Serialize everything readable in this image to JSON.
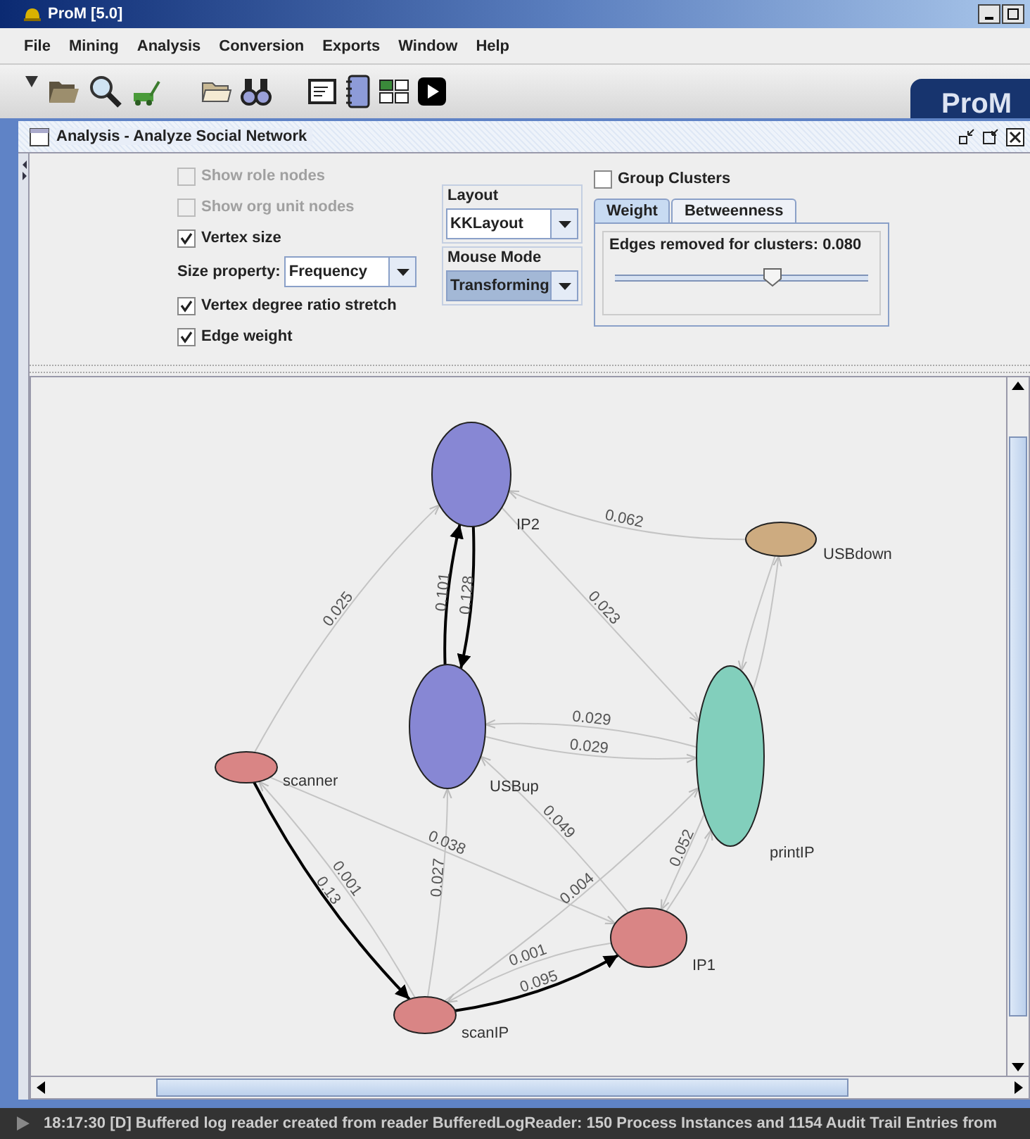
{
  "window": {
    "title": "ProM [5.0]"
  },
  "menu": [
    "File",
    "Mining",
    "Analysis",
    "Conversion",
    "Exports",
    "Window",
    "Help"
  ],
  "logo": "ProM",
  "frame": {
    "title": "Analysis - Analyze Social Network"
  },
  "options": [
    {
      "kind": "checkbox",
      "label": "Show role nodes",
      "checked": false,
      "disabled": true
    },
    {
      "kind": "checkbox",
      "label": "Show org unit nodes",
      "checked": false,
      "disabled": true
    },
    {
      "kind": "checkbox",
      "label": "Vertex size",
      "checked": true,
      "disabled": false
    },
    {
      "kind": "combo",
      "label": "Size property:",
      "value": "Frequency"
    },
    {
      "kind": "checkbox",
      "label": "Vertex degree ratio stretch",
      "checked": true,
      "disabled": false
    },
    {
      "kind": "checkbox",
      "label": "Edge weight",
      "checked": true,
      "disabled": false
    }
  ],
  "layout": {
    "title": "Layout",
    "value": "KKLayout"
  },
  "mouse_mode": {
    "title": "Mouse Mode",
    "value": "Transforming"
  },
  "group_clusters": {
    "label": "Group Clusters",
    "checked": false
  },
  "cluster_tabs": [
    {
      "label": "Weight",
      "selected": true
    },
    {
      "label": "Betweenness",
      "selected": false
    }
  ],
  "edges_removed": {
    "label": "Edges removed for clusters: 0.080",
    "level": 0.62
  },
  "nodes": [
    {
      "name": "IP2",
      "color": "#8787d4"
    },
    {
      "name": "USBup",
      "color": "#8787d4"
    },
    {
      "name": "USBdown",
      "color": "#cdab80"
    },
    {
      "name": "printIP",
      "color": "#82cfbc"
    },
    {
      "name": "scanner",
      "color": "#d98585"
    },
    {
      "name": "IP1",
      "color": "#d98585"
    },
    {
      "name": "scanIP",
      "color": "#d98585"
    }
  ],
  "edges": [
    {
      "label": "0.062",
      "strong": false
    },
    {
      "label": "0.025",
      "strong": false
    },
    {
      "label": "0.101",
      "strong": true
    },
    {
      "label": "0.128",
      "strong": true
    },
    {
      "label": "0.023",
      "strong": false
    },
    {
      "label": "0.029",
      "strong": false
    },
    {
      "label": "0.029",
      "strong": false
    },
    {
      "label": "0.049",
      "strong": false
    },
    {
      "label": "0.027",
      "strong": false
    },
    {
      "label": "0.052",
      "strong": false
    },
    {
      "label": "0.004",
      "strong": false
    },
    {
      "label": "0.001",
      "strong": false
    },
    {
      "label": "0.13",
      "strong": true
    },
    {
      "label": "0.038",
      "strong": false
    },
    {
      "label": "0.001",
      "strong": false
    },
    {
      "label": "0.095",
      "strong": true
    },
    {
      "strong": false
    },
    {
      "strong": false
    },
    {
      "strong": false
    }
  ],
  "status_bar": "18:17:30 [D] Buffered log reader created from reader BufferedLogReader: 150 Process Instances and 1154 Audit Trail Entries from"
}
